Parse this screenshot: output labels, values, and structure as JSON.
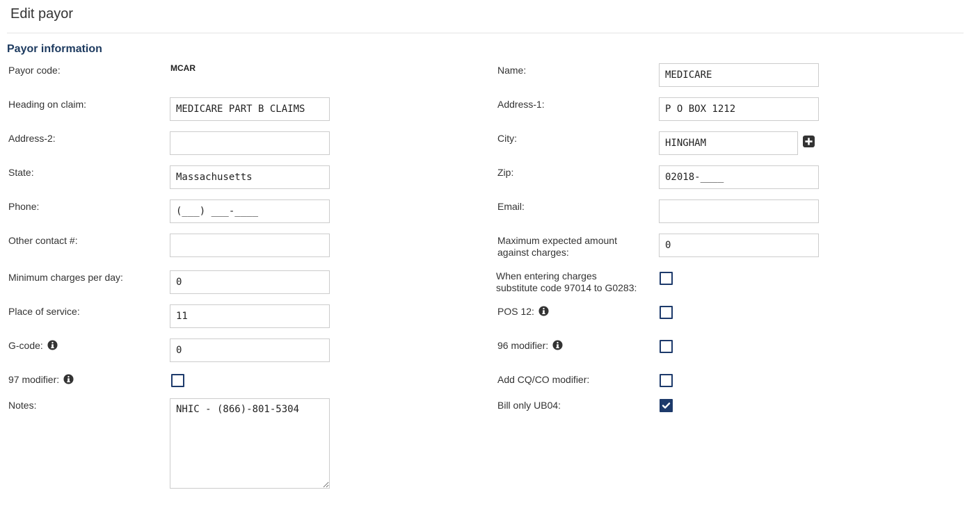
{
  "page": {
    "title": "Edit payor"
  },
  "section": {
    "title": "Payor information"
  },
  "left": {
    "payor_code_label": "Payor code:",
    "payor_code_value": "MCAR",
    "heading_label": "Heading on claim:",
    "heading_value": "MEDICARE PART B CLAIMS",
    "address2_label": "Address-2:",
    "address2_value": "",
    "state_label": "State:",
    "state_value": "Massachusetts",
    "phone_label": "Phone:",
    "phone_value": "(___) ___-____",
    "other_contact_label": "Other contact #:",
    "other_contact_value": "",
    "min_charges_label": "Minimum charges per day:",
    "min_charges_value": "0",
    "pos_label": "Place of service:",
    "pos_value": "11",
    "gcode_label": "G-code:",
    "gcode_value": "0",
    "mod97_label": "97 modifier:",
    "mod97_checked": false,
    "notes_label": "Notes:",
    "notes_value": "NHIC - (866)-801-5304"
  },
  "right": {
    "name_label": "Name:",
    "name_value": "MEDICARE",
    "address1_label": "Address-1:",
    "address1_value": "P O BOX 1212",
    "city_label": "City:",
    "city_value": "HINGHAM",
    "zip_label": "Zip:",
    "zip_value": "02018-____",
    "email_label": "Email:",
    "email_value": "",
    "max_expected_label_1": "Maximum expected amount",
    "max_expected_label_2": "against charges:",
    "max_expected_value": "0",
    "substitute_label_1": "When entering charges",
    "substitute_label_2": "substitute code 97014 to G0283:",
    "substitute_checked": false,
    "pos12_label": "POS 12:",
    "pos12_checked": false,
    "mod96_label": "96 modifier:",
    "mod96_checked": false,
    "cqco_label": "Add CQ/CO modifier:",
    "cqco_checked": false,
    "ub04_label": "Bill only UB04:",
    "ub04_checked": true
  },
  "icons": {
    "info": "info-circle-icon",
    "add": "plus-square-icon",
    "check": "check-icon"
  },
  "colors": {
    "heading": "#1d3a5f",
    "checkbox": "#1d3a6b",
    "border": "#cccccc"
  }
}
